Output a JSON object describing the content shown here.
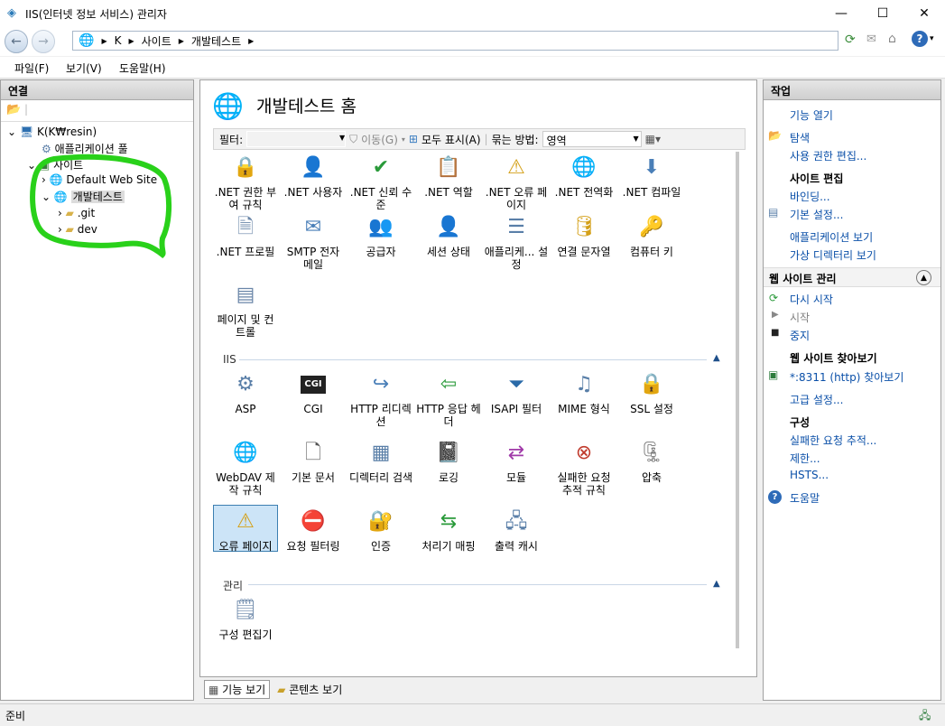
{
  "window": {
    "title": "IIS(인터넷 정보 서비스) 관리자",
    "min": "—",
    "max": "☐",
    "close": "✕"
  },
  "address": {
    "segments": [
      "K",
      "사이트",
      "개발테스트"
    ]
  },
  "menus": [
    "파일(F)",
    "보기(V)",
    "도움말(H)"
  ],
  "connections": {
    "title": "연결",
    "tree": [
      {
        "label": "K(K₩resin)"
      },
      {
        "label": "애플리케이션 풀"
      },
      {
        "label": "사이트"
      },
      {
        "label": "Default Web Site"
      },
      {
        "label": "개발테스트"
      },
      {
        "label": ".git"
      },
      {
        "label": "dev"
      }
    ]
  },
  "center": {
    "title": "개발테스트 홈",
    "filter": {
      "label": "필터:",
      "go": "이동(G)",
      "showall": "모두 표시(A)",
      "groupby": "묶는 방법:",
      "group_value": "영역"
    },
    "aspnet": [
      ".NET 권한 부여 규칙",
      ".NET 사용자",
      ".NET 신뢰 수준",
      ".NET 역할",
      ".NET 오류 페이지",
      ".NET 전역화",
      ".NET 컴파일",
      ".NET 프로필",
      "SMTP 전자 메일",
      "공급자",
      "세션 상태",
      "애플리케... 설정",
      "연결 문자열",
      "컴퓨터 키",
      "페이지 및 컨트롤"
    ],
    "iis_label": "IIS",
    "iis": [
      "ASP",
      "CGI",
      "HTTP 리디렉션",
      "HTTP 응답 헤더",
      "ISAPI 필터",
      "MIME 형식",
      "SSL 설정",
      "WebDAV 제작 규칙",
      "기본 문서",
      "디렉터리 검색",
      "로깅",
      "모듈",
      "실패한 요청 추적 규칙",
      "압축",
      "오류 페이지",
      "요청 필터링",
      "인증",
      "처리기 매핑",
      "출력 캐시"
    ],
    "mgmt_label": "관리",
    "mgmt": [
      "구성 편집기"
    ],
    "tabs": [
      "기능 보기",
      "콘텐츠 보기"
    ]
  },
  "actions": {
    "title": "작업",
    "open": "기능 열기",
    "explore": "탐색",
    "perm": "사용 권한 편집...",
    "site_edit": "사이트 편집",
    "binding": "바인딩...",
    "basic": "기본 설정...",
    "viewapps": "애플리케이션 보기",
    "viewvdirs": "가상 디렉터리 보기",
    "manage": "웹 사이트 관리",
    "restart": "다시 시작",
    "start": "시작",
    "stop": "중지",
    "browse_h": "웹 사이트 찾아보기",
    "browse": "*:8311 (http) 찾아보기",
    "adv": "고급 설정...",
    "config": "구성",
    "failed": "실패한 요청 추적...",
    "limits": "제한...",
    "hsts": "HSTS...",
    "help": "도움말"
  },
  "status": {
    "text": "준비"
  },
  "colors": {
    "annotation": "#29d11a",
    "link": "#0a4fa8"
  }
}
